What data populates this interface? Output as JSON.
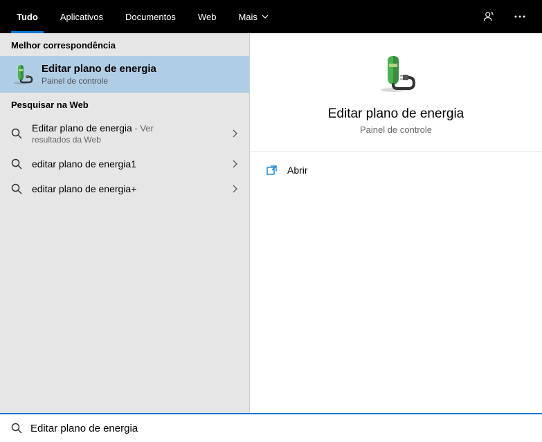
{
  "tabs": {
    "tudo": "Tudo",
    "aplicativos": "Aplicativos",
    "documentos": "Documentos",
    "web": "Web",
    "mais": "Mais"
  },
  "left": {
    "bestHeader": "Melhor correspondência",
    "best": {
      "title": "Editar plano de energia",
      "subtitle": "Painel de controle"
    },
    "webHeader": "Pesquisar na Web",
    "webItems": [
      {
        "text": "Editar plano de energia",
        "suffix": " - Ver",
        "sub": "resultados da Web"
      },
      {
        "text": "editar plano de energia1",
        "suffix": "",
        "sub": ""
      },
      {
        "text": "editar plano de energia+",
        "suffix": "",
        "sub": ""
      }
    ]
  },
  "detail": {
    "title": "Editar plano de energia",
    "subtitle": "Painel de controle",
    "actions": {
      "open": "Abrir"
    }
  },
  "search": {
    "value": "Editar plano de energia"
  }
}
